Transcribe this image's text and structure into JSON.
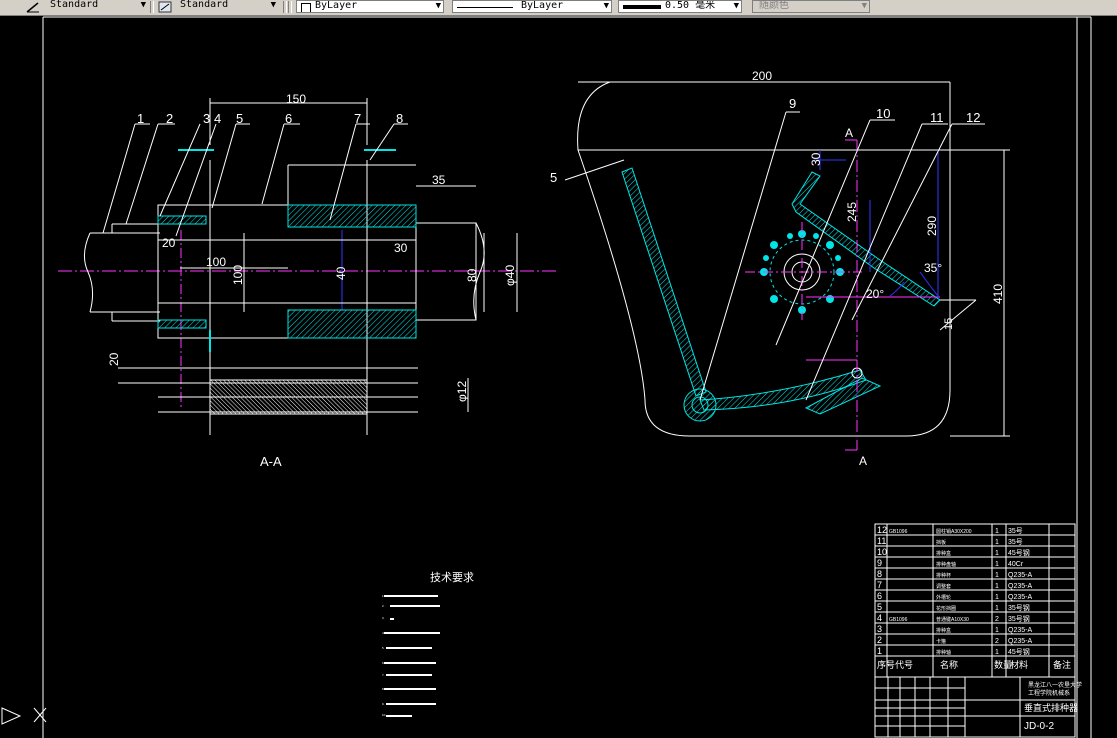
{
  "toolbar": {
    "text_style": "Standard",
    "dim_style": "Standard",
    "layer": "ByLayer",
    "linetype": "ByLayer",
    "lineweight": "0.50 毫米",
    "color": "随颜色"
  },
  "drawing": {
    "dims": {
      "d150": "150",
      "d35": "35",
      "d20a": "20",
      "d30": "30",
      "d100": "100",
      "d100v": "100",
      "d40": "40",
      "d80": "80",
      "d40b": "φ40",
      "d20b": "20",
      "d12": "φ12",
      "d200": "200",
      "d30t": "30",
      "d245": "245",
      "d290": "290",
      "d35deg": "35°",
      "d20deg": "20°",
      "d410": "410",
      "d15": "15"
    },
    "part_numbers": [
      "1",
      "2",
      "3",
      "4",
      "5",
      "6",
      "7",
      "8",
      "5",
      "9",
      "10",
      "11",
      "12"
    ],
    "section_marks": [
      "A",
      "A"
    ],
    "section_view_label": "A-A"
  },
  "tech_requirements": {
    "title": "技术要求",
    "lines": [
      "1.",
      "2.",
      "3.",
      "4.",
      "5.",
      "6.",
      "7.",
      "8.",
      "9.",
      "10."
    ]
  },
  "bom": {
    "rows": [
      {
        "no": "12",
        "code": "GB1096",
        "name": "圆柱销A30X200",
        "qty": "1",
        "material": "35号"
      },
      {
        "no": "11",
        "code": "",
        "name": "挡板",
        "qty": "1",
        "material": "35号"
      },
      {
        "no": "10",
        "code": "",
        "name": "排种盒",
        "qty": "1",
        "material": "45号钢"
      },
      {
        "no": "9",
        "code": "",
        "name": "排种盘轴",
        "qty": "1",
        "material": "40Cr"
      },
      {
        "no": "8",
        "code": "",
        "name": "排种杯",
        "qty": "1",
        "material": "Q235-A"
      },
      {
        "no": "7",
        "code": "",
        "name": "调整套",
        "qty": "1",
        "material": "Q235-A"
      },
      {
        "no": "6",
        "code": "",
        "name": "外槽轮",
        "qty": "1",
        "material": "Q235-A"
      },
      {
        "no": "5",
        "code": "",
        "name": "花形挡圈",
        "qty": "1",
        "material": "35号钢"
      },
      {
        "no": "4",
        "code": "GB1096",
        "name": "普通键A10X30",
        "qty": "2",
        "material": "35号钢"
      },
      {
        "no": "3",
        "code": "",
        "name": "排种盒",
        "qty": "1",
        "material": "Q235-A"
      },
      {
        "no": "2",
        "code": "",
        "name": "卡箍",
        "qty": "2",
        "material": "Q235-A"
      },
      {
        "no": "1",
        "code": "",
        "name": "排种轴",
        "qty": "1",
        "material": "45号钢"
      }
    ],
    "headers": {
      "no": "序号",
      "code": "代号",
      "name": "名称",
      "qty": "数量",
      "material": "材料",
      "note": "备注"
    }
  },
  "title_block": {
    "school_line1": "黑龙江八一农垦大学",
    "school_line2": "工程学院机械系",
    "drawing_name": "垂直式排种器",
    "drawing_no": "JD-0-2"
  },
  "ucs_icon": "ucs-icon"
}
